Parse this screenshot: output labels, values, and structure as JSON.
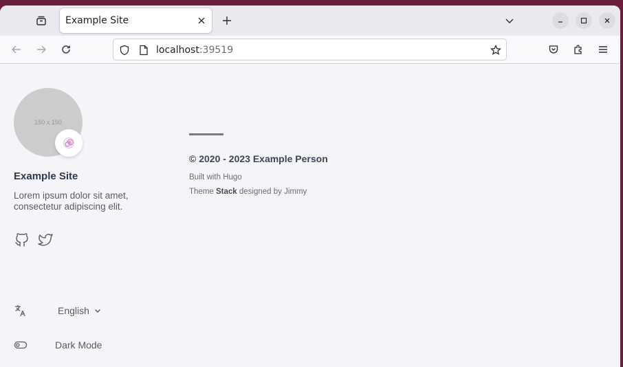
{
  "browser": {
    "tab": {
      "title": "Example Site",
      "close_icon": "close-icon"
    },
    "url": {
      "host": "localhost",
      "port": ":39519"
    }
  },
  "sidebar": {
    "avatar_placeholder": "150 x 150",
    "emoji": "🍥",
    "title": "Example Site",
    "description": "Lorem ipsum dolor sit amet, consectetur adipiscing elit.",
    "social": [
      "github-icon",
      "twitter-icon"
    ],
    "language": {
      "label": "English"
    },
    "dark_mode": {
      "label": "Dark Mode"
    }
  },
  "footer": {
    "copyright": "© 2020 - 2023 Example Person",
    "built_with": "Built with Hugo",
    "theme_prefix": "Theme ",
    "theme_name": "Stack",
    "theme_suffix": " designed by Jimmy"
  }
}
